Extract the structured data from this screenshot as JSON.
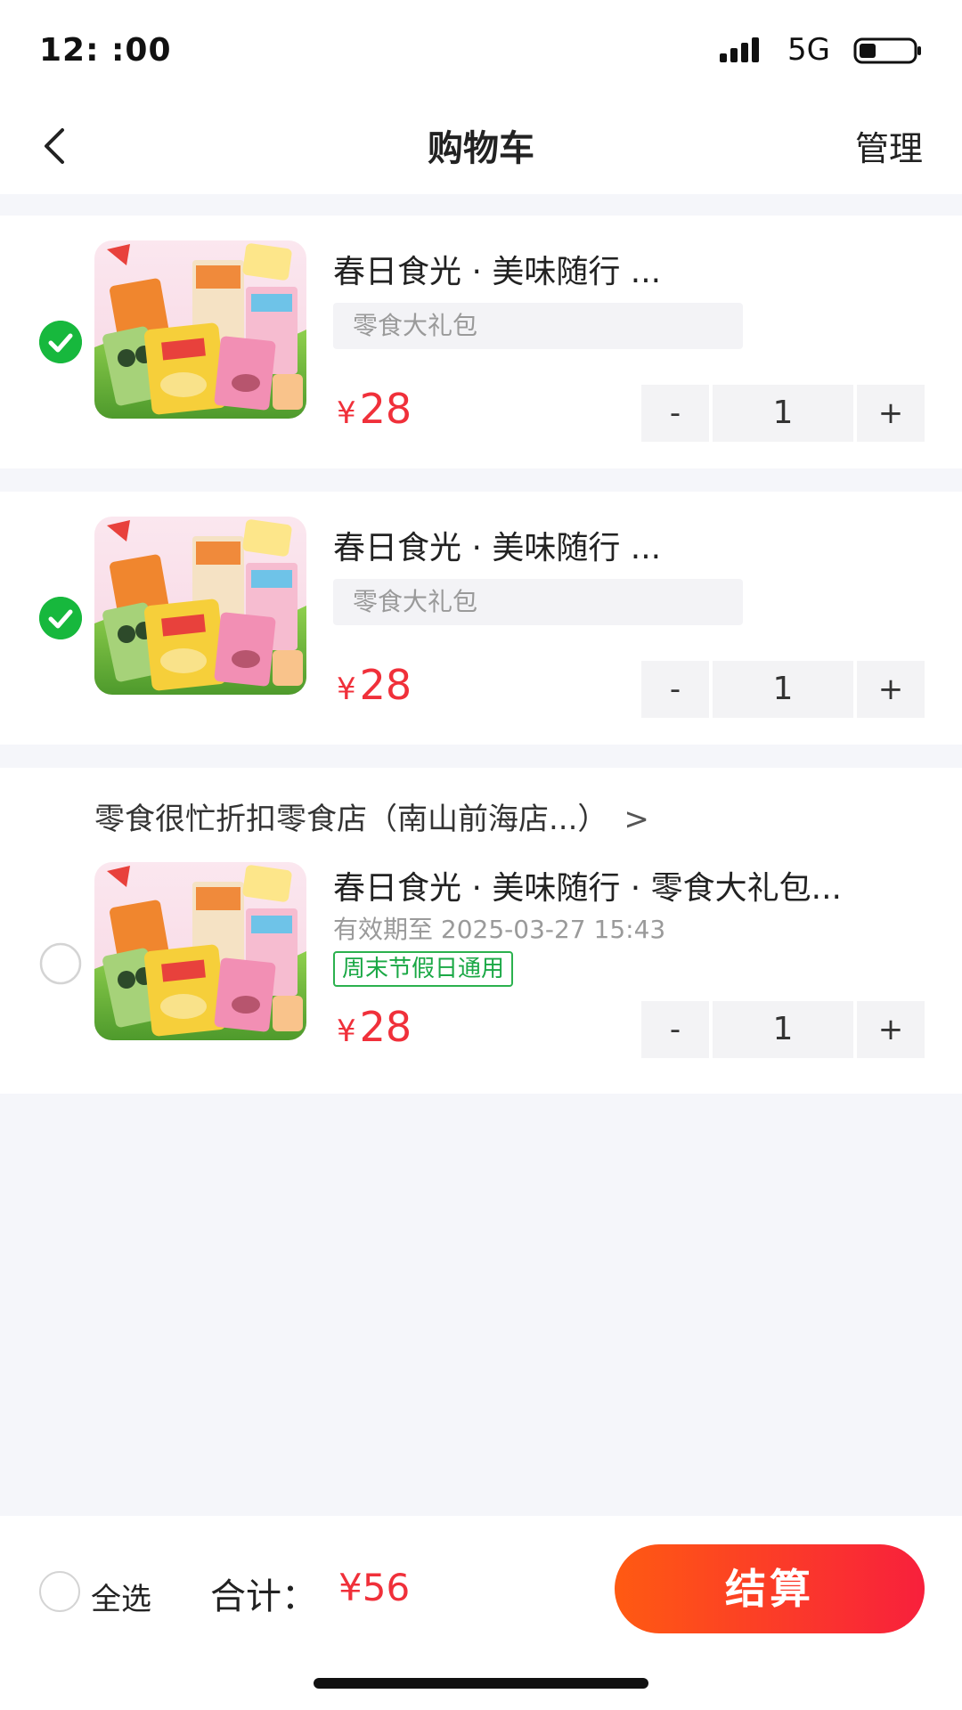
{
  "status_bar": {
    "time": "12:  :00",
    "network": "5G"
  },
  "nav": {
    "title": "购物车",
    "manage": "管理"
  },
  "cart_items": [
    {
      "checked": true,
      "title": "春日食光 · 美味随行 ...",
      "spec": "零食大礼包",
      "price_symbol": "¥",
      "price": "28",
      "quantity": "1",
      "minus": "-",
      "plus": "+"
    },
    {
      "checked": true,
      "title": "春日食光 · 美味随行 ...",
      "spec": "零食大礼包",
      "price_symbol": "¥",
      "price": "28",
      "quantity": "1",
      "minus": "-",
      "plus": "+"
    }
  ],
  "store_section": {
    "store_name": "零食很忙折扣零食店（南山前海店...）",
    "chevron": ">",
    "item": {
      "checked": false,
      "title": "春日食光 · 美味随行 · 零食大礼包...",
      "expiry": "有效期至 2025-03-27 15:43",
      "tag": "周末节假日通用",
      "price_symbol": "¥",
      "price": "28",
      "quantity": "1",
      "minus": "-",
      "plus": "+"
    }
  },
  "footer": {
    "select_all": "全选",
    "total_label": "合计：",
    "total_value": "¥56",
    "checkout": "结算"
  },
  "colors": {
    "accent_red": "#f0303a",
    "check_green": "#17b83d",
    "tag_green": "#1aa845",
    "checkout_gradient_start": "#ff5a12",
    "checkout_gradient_end": "#f8203c",
    "page_background": "#f5f6fa"
  },
  "icons": {
    "back": "chevron-left-icon",
    "signal": "signal-bars-icon",
    "battery": "battery-icon",
    "checked": "check-circle-icon",
    "unchecked": "empty-circle-icon"
  }
}
